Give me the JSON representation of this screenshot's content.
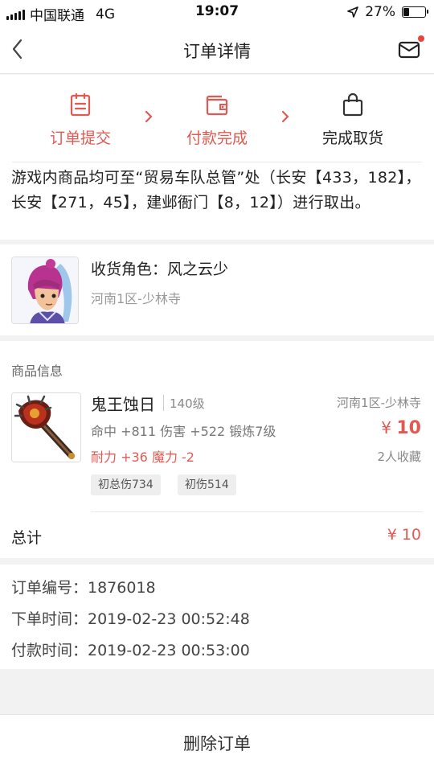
{
  "status_bar": {
    "carrier": "中国联通",
    "network": "4G",
    "time": "19:07",
    "battery": "27%",
    "battery_level": 0.27,
    "icons": [
      "signal-icon",
      "location-arrow-icon",
      "battery-icon"
    ]
  },
  "nav": {
    "title": "订单详情",
    "back_icon": "chevron-left-icon",
    "mail_icon": "mail-icon",
    "has_unread": true
  },
  "steps": [
    {
      "label": "订单提交",
      "icon": "clipboard-icon",
      "state": "done"
    },
    {
      "label": "付款完成",
      "icon": "wallet-icon",
      "state": "done"
    },
    {
      "label": "完成取货",
      "icon": "bag-icon",
      "state": "pending"
    }
  ],
  "notice": "游戏内商品均可至“贸易车队总管”处（长安【433，182】，长安【271，45】，建邺衙门【8，12】）进行取出。",
  "role": {
    "name_label": "收货角色：风之云少",
    "server": "河南1区-少林寺"
  },
  "goods": {
    "header": "商品信息",
    "item_name": "鬼王蚀日",
    "level": "140级",
    "stats_line1": "命中 +811 伤害 +522 锻炼7级",
    "stats_line2": "耐力 +36 魔力 -2",
    "server": "河南1区-少林寺",
    "price_symbol": "¥",
    "price": "10",
    "favorites": "2人收藏",
    "tags": [
      "初总伤734",
      "初伤514"
    ]
  },
  "total": {
    "label": "总计",
    "amount": "¥ 10"
  },
  "order": {
    "number": "订单编号：1876018",
    "created": "下单时间：2019-02-23 00:52:48",
    "paid": "付款时间：2019-02-23 00:53:00"
  },
  "actions": {
    "delete_label": "删除订单"
  },
  "colors": {
    "accent": "#e05a52",
    "background": "#f2f2f2"
  }
}
